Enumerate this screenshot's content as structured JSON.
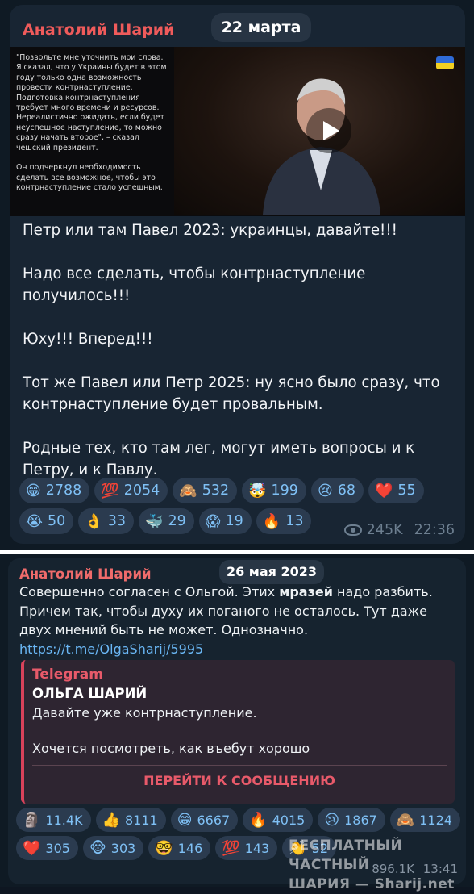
{
  "post1": {
    "author": "Анатолий Шарий",
    "date": "22 марта",
    "image_quote": "\"Позвольте мне уточнить мои слова. Я сказал, что у Украины будет в этом году только одна возможность провести контрнаступление. Подготовка контрнаступления требует много времени и ресурсов. Нереалистично ожидать, если будет неуспешное наступление, то можно сразу начать второе\", – сказал чешский президент.\n\nОн подчеркнул необходимость сделать все возможное, чтобы это контрнаступление стало успешным.",
    "paragraphs": [
      "Петр или там Павел 2023: украинцы, давайте!!!",
      "Надо все сделать, чтобы контрнаступление получилось!!!",
      "Юху!!! Вперед!!!",
      "Тот же Павел или Петр 2025: ну ясно было сразу, что контрнаступление будет провальным.",
      "Родные тех, кто там лег, могут иметь вопросы и к Петру, и к Павлу."
    ],
    "reactions": [
      {
        "emoji": "😁",
        "count": "2788"
      },
      {
        "emoji": "💯",
        "count": "2054"
      },
      {
        "emoji": "🙈",
        "count": "532"
      },
      {
        "emoji": "🤯",
        "count": "199"
      },
      {
        "emoji": "😢",
        "count": "68"
      },
      {
        "emoji": "❤️",
        "count": "55"
      },
      {
        "emoji": "😭",
        "count": "50"
      },
      {
        "emoji": "👌",
        "count": "33"
      },
      {
        "emoji": "🐳",
        "count": "29"
      },
      {
        "emoji": "😱",
        "count": "19"
      },
      {
        "emoji": "🔥",
        "count": "13"
      }
    ],
    "views": "245K",
    "time": "22:36"
  },
  "post2": {
    "author": "Анатолий Шарий",
    "date": "26 мая 2023",
    "text_before": "Совершенно согласен с Ольгой. Этих ",
    "text_bold": "мразей",
    "text_after": " надо разбить. Причем так, чтобы духу их поганого не осталось. Тут даже двух мнений быть не может. Однозначно.",
    "link": "https://t.me/OlgaSharij/5995",
    "forward": {
      "source": "Telegram",
      "name": "ОЛЬГА ШАРИЙ",
      "line1": "Давайте уже контрнаступление.",
      "line2": "Хочется посмотреть, как въебут хорошо",
      "button": "ПЕРЕЙТИ К СООБЩЕНИЮ"
    },
    "reactions": [
      {
        "emoji": "🗿",
        "count": "11.4K"
      },
      {
        "emoji": "👍",
        "count": "8111"
      },
      {
        "emoji": "😁",
        "count": "6667"
      },
      {
        "emoji": "🔥",
        "count": "4015"
      },
      {
        "emoji": "😢",
        "count": "1867"
      },
      {
        "emoji": "🙈",
        "count": "1124"
      },
      {
        "emoji": "❤️",
        "count": "305"
      },
      {
        "emoji": "🐵",
        "count": "303"
      },
      {
        "emoji": "🤓",
        "count": "146"
      },
      {
        "emoji": "💯",
        "count": "143"
      },
      {
        "emoji": "👏",
        "count": "52"
      }
    ],
    "views": "896.1K",
    "time": "13:41"
  },
  "watermark": {
    "line1": "БЕСПЛАТНЫЙ ЧАСТНЫЙ",
    "line2": "ШАРИЯ — Sharij.net"
  },
  "colors": {
    "author": "#ef5b5b",
    "reaction_pill": "#2b3b4f",
    "link": "#6ab7f5",
    "forward_accent": "#d9425a"
  }
}
